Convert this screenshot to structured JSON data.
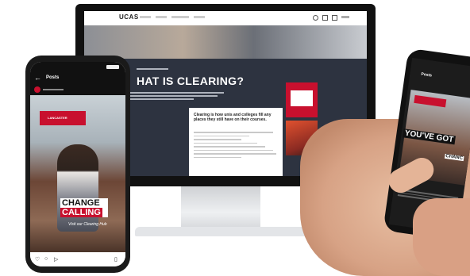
{
  "website": {
    "logo": "UCAS",
    "nav": [
      "",
      "",
      "",
      ""
    ],
    "hero_title": "HAT IS CLEARING?",
    "card_title": "Clearing is how unis and colleges fill any places they still have on their courses.",
    "colors": {
      "accent": "#c8102e",
      "dark": "#2d3340"
    }
  },
  "phone_left": {
    "header_title": "Posts",
    "logo_text": "LANCASTER",
    "headline_1": "CHANGE IS",
    "headline_2": "CALLING",
    "subline": "Visit our Clearing Hub"
  },
  "phone_right": {
    "header_title": "Posts",
    "headline": "YOU'VE GOT",
    "headline_2": "CHANC"
  }
}
